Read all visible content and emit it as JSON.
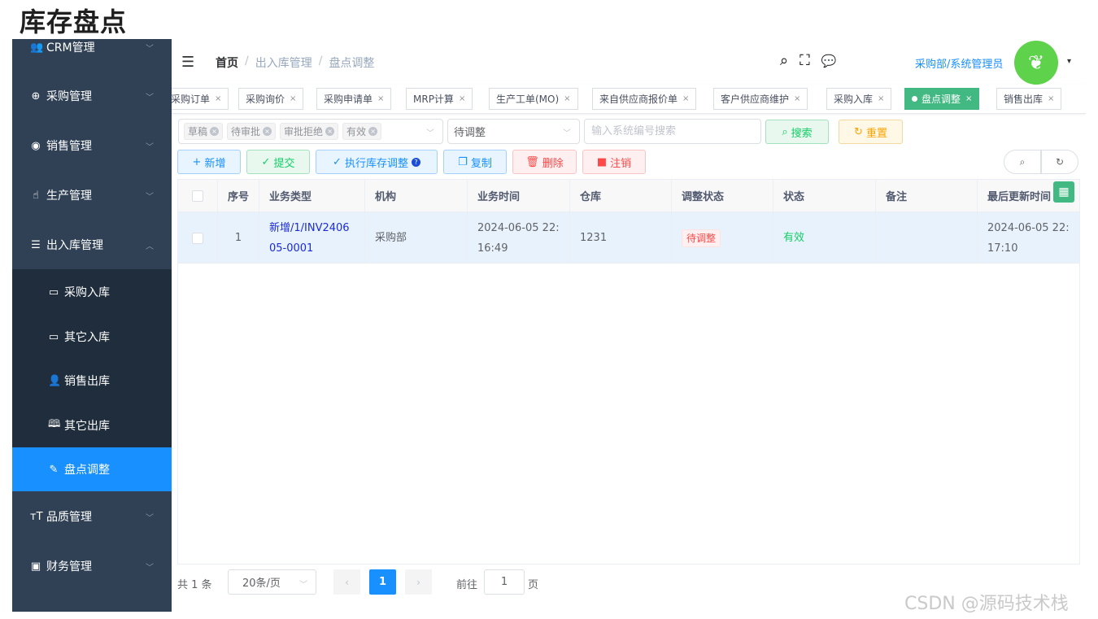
{
  "page_heading": "库存盘点",
  "sidebar": {
    "menus": [
      {
        "label": "CRM管理",
        "icon": "users-icon",
        "glyph": "👥",
        "arrow": "﹀"
      },
      {
        "label": "采购管理",
        "icon": "globe-icon",
        "glyph": "⊕",
        "arrow": "﹀"
      },
      {
        "label": "销售管理",
        "icon": "compass-icon",
        "glyph": "◉",
        "arrow": "﹀"
      },
      {
        "label": "生产管理",
        "icon": "hand-icon",
        "glyph": "☝",
        "arrow": "﹀"
      },
      {
        "label": "出入库管理",
        "icon": "database-icon",
        "glyph": "☰",
        "arrow": "︿"
      }
    ],
    "submenus": [
      {
        "label": "采购入库",
        "icon": "chat-icon",
        "glyph": "▭"
      },
      {
        "label": "其它入库",
        "icon": "input-icon",
        "glyph": "▭"
      },
      {
        "label": "销售出库",
        "icon": "user-icon",
        "glyph": "👤"
      },
      {
        "label": "其它出库",
        "icon": "book-icon",
        "glyph": "🕮"
      },
      {
        "label": "盘点调整",
        "icon": "edit-icon",
        "glyph": "✎"
      }
    ],
    "menus_bottom": [
      {
        "label": "品质管理",
        "icon": "text-size-icon",
        "glyph": "ᴛT",
        "arrow": "﹀"
      },
      {
        "label": "财务管理",
        "icon": "monitor-icon",
        "glyph": "▣",
        "arrow": "﹀"
      }
    ]
  },
  "navbar": {
    "hamburger": "☰",
    "breadcrumb": [
      "首页",
      "出入库管理",
      "盘点调整"
    ],
    "breadcrumb_sep": "/",
    "search_icon": "⌕",
    "fullscreen_icon": "⛶",
    "chat_icon": "💬",
    "user": "采购部/系统管理员",
    "caret": "▾"
  },
  "tags": [
    {
      "label": "采购订单",
      "close": "×"
    },
    {
      "label": "采购询价",
      "close": "×"
    },
    {
      "label": "采购申请单",
      "close": "×"
    },
    {
      "label": "MRP计算",
      "close": "×"
    },
    {
      "label": "生产工单(MO)",
      "close": "×"
    },
    {
      "label": "来自供应商报价单",
      "close": "×"
    },
    {
      "label": "客户供应商维护",
      "close": "×"
    },
    {
      "label": "采购入库",
      "close": "×"
    },
    {
      "label": "盘点调整",
      "close": "×"
    },
    {
      "label": "销售出库",
      "close": "×"
    }
  ],
  "filters": {
    "status_chips": [
      "草稿",
      "待审批",
      "审批拒绝",
      "有效"
    ],
    "chip_close": "×",
    "adjust_status": "待调整",
    "search_placeholder": "输入系统编号搜索",
    "search_btn": "搜索",
    "reset_btn": "重置",
    "arrow": "﹀"
  },
  "toolbar": {
    "add": "新增",
    "submit": "提交",
    "execute": "执行库存调整",
    "copy": "复制",
    "delete": "删除",
    "cancel": "注销",
    "search_icon": "⌕",
    "refresh_icon": "↻"
  },
  "table": {
    "headers": [
      "序号",
      "业务类型",
      "机构",
      "业务时间",
      "仓库",
      "调整状态",
      "状态",
      "备注",
      "最后更新时间"
    ],
    "rows": [
      {
        "index": "1",
        "business_type": "新增/1/INV240605-0001",
        "org": "采购部",
        "business_time": "2024-06-05 22:16:49",
        "warehouse": "1231",
        "adjust_status": "待调整",
        "status": "有效",
        "remark": "",
        "updated": "2024-06-05 22:17:10"
      }
    ]
  },
  "pagination": {
    "total": "共 1 条",
    "page_size": "20条/页",
    "current": "1",
    "goto_label": "前往",
    "goto_value": "1",
    "page_label": "页",
    "prev": "‹",
    "next": "›"
  },
  "watermark": "CSDN @源码技术栈",
  "colors": {
    "sidebar": "#304156",
    "submenu": "#1f2d3d",
    "active": "#1890ff",
    "tag_active": "#42b983"
  }
}
